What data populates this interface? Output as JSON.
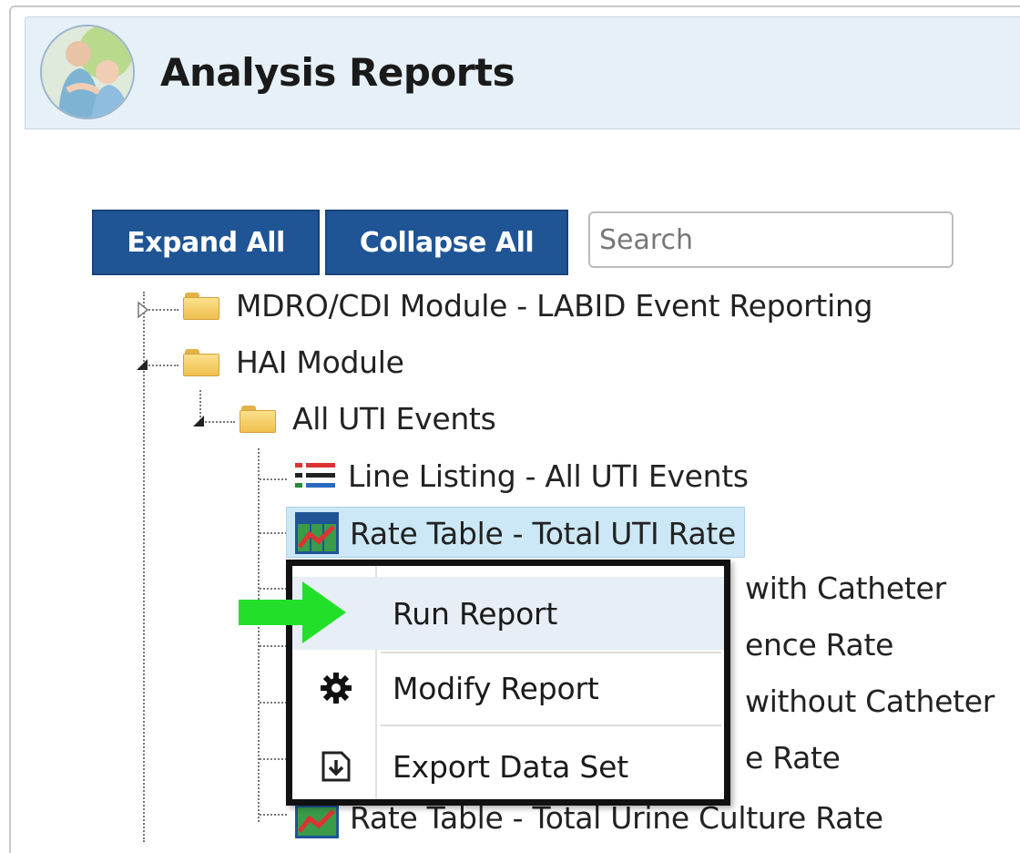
{
  "header": {
    "title": "Analysis Reports"
  },
  "toolbar": {
    "expand_label": "Expand All",
    "collapse_label": "Collapse All",
    "search_placeholder": "Search"
  },
  "tree": {
    "mdro": "MDRO/CDI Module - LABID Event Reporting",
    "hai": "HAI Module",
    "uti": "All UTI Events",
    "line_listing": "Line Listing - All UTI Events",
    "rate_total": "Rate Table - Total UTI Rate",
    "partial_1": "with Catheter",
    "partial_2": "ence Rate",
    "partial_3": "without Catheter",
    "partial_4": "e Rate",
    "rate_urine": "Rate Table - Total Urine Culture Rate"
  },
  "context_menu": {
    "items": [
      {
        "label": "Run Report",
        "icon": "run-icon"
      },
      {
        "label": "Modify Report",
        "icon": "gear-icon"
      },
      {
        "label": "Export Data Set",
        "icon": "export-icon"
      }
    ]
  },
  "colors": {
    "accent": "#1f5595",
    "header_bg": "#e6f0f8",
    "selection": "#cce8f6",
    "callout_arrow": "#22dd22"
  }
}
